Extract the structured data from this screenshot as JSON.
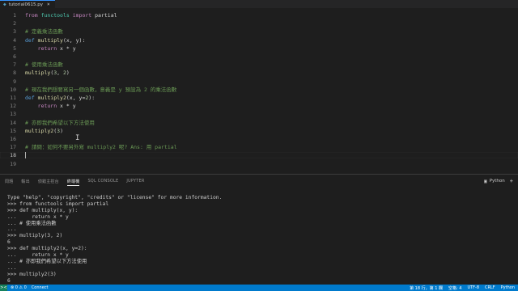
{
  "tab": {
    "filename": "tutorial0615.py",
    "close": "×"
  },
  "editor": {
    "lines": [
      {
        "n": "1",
        "tokens": [
          [
            "kw2",
            "from "
          ],
          [
            "mod",
            "functools"
          ],
          [
            "kw2",
            " import "
          ],
          [
            "pl",
            "partial"
          ]
        ]
      },
      {
        "n": "2",
        "tokens": []
      },
      {
        "n": "3",
        "tokens": [
          [
            "cm",
            "# 定義乘法函數"
          ]
        ]
      },
      {
        "n": "4",
        "tokens": [
          [
            "kw",
            "def "
          ],
          [
            "fn",
            "multiply"
          ],
          [
            "pl",
            "(x, y):"
          ]
        ]
      },
      {
        "n": "5",
        "tokens": [
          [
            "pl",
            "    "
          ],
          [
            "kw2",
            "return"
          ],
          [
            "pl",
            " x * y"
          ]
        ]
      },
      {
        "n": "6",
        "tokens": []
      },
      {
        "n": "7",
        "tokens": [
          [
            "cm",
            "# 使用乘法函數"
          ]
        ]
      },
      {
        "n": "8",
        "tokens": [
          [
            "fn",
            "multiply"
          ],
          [
            "pl",
            "("
          ],
          [
            "num",
            "3"
          ],
          [
            "pl",
            ", "
          ],
          [
            "num",
            "2"
          ],
          [
            "pl",
            ")"
          ]
        ]
      },
      {
        "n": "9",
        "tokens": []
      },
      {
        "n": "10",
        "tokens": [
          [
            "cm",
            "# 現在我們想要寫另一個函數，意義是 y 預設為 2 的乘法函數"
          ]
        ]
      },
      {
        "n": "11",
        "tokens": [
          [
            "kw",
            "def "
          ],
          [
            "fn",
            "multiply2"
          ],
          [
            "pl",
            "(x, y="
          ],
          [
            "num",
            "2"
          ],
          [
            "pl",
            "):"
          ]
        ]
      },
      {
        "n": "12",
        "tokens": [
          [
            "pl",
            "    "
          ],
          [
            "kw2",
            "return"
          ],
          [
            "pl",
            " x * y"
          ]
        ]
      },
      {
        "n": "13",
        "tokens": []
      },
      {
        "n": "14",
        "tokens": [
          [
            "cm",
            "# 亦即我們希望以下方法使用"
          ]
        ]
      },
      {
        "n": "15",
        "tokens": [
          [
            "fn",
            "multiply2"
          ],
          [
            "pl",
            "("
          ],
          [
            "num",
            "3"
          ],
          [
            "pl",
            ")"
          ]
        ]
      },
      {
        "n": "16",
        "tokens": []
      },
      {
        "n": "17",
        "tokens": [
          [
            "cm",
            "# 請問：如何不要另外寫 multiply2 呢? Ans: 用 partial"
          ]
        ]
      },
      {
        "n": "18",
        "tokens": []
      },
      {
        "n": "19",
        "tokens": []
      }
    ],
    "active_line": "18",
    "ibeam": "I"
  },
  "panel": {
    "tabs": [
      {
        "label": "問題",
        "active": false
      },
      {
        "label": "輸出",
        "active": false
      },
      {
        "label": "偵錯主控台",
        "active": false
      },
      {
        "label": "終端機",
        "active": true
      },
      {
        "label": "SQL CONSOLE",
        "active": false
      },
      {
        "label": "JUPYTER",
        "active": false
      }
    ],
    "terminal_name": "Python",
    "terminal_icon": "terminal-icon",
    "plus": "+",
    "lines": [
      "Type \"help\", \"copyright\", \"credits\" or \"license\" for more information.",
      ">>> from functools import partial",
      ">>> def multiply(x, y):",
      "...     return x * y",
      "... # 使用乘法函數",
      "...",
      ">>> multiply(3, 2)",
      "6",
      ">>> def multiply2(x, y=2):",
      "...     return x * y",
      "... # 亦即我們希望以下方法使用",
      "...",
      ">>> multiply2(3)",
      "6",
      ">>> "
    ]
  },
  "status": {
    "remote_icon": "><",
    "left": [
      "⊗ 0 ⚠ 0",
      "Connect"
    ],
    "right": [
      "第 18 行，第 1 欄",
      "空格: 4",
      "UTF-8",
      "CRLF",
      "Python"
    ]
  },
  "colors": {
    "status_bar": "#007acc",
    "background": "#1e1e1e",
    "comment": "#6a9955"
  }
}
